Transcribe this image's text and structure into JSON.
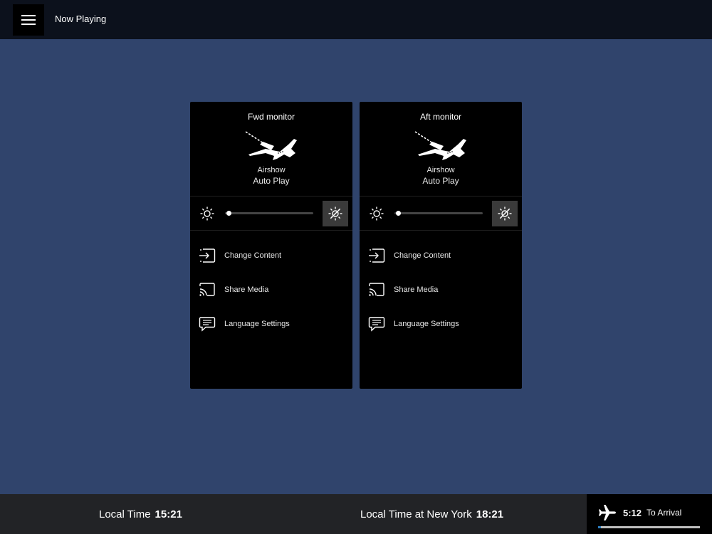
{
  "header": {
    "title": "Now Playing",
    "menu_icon": "hamburger-menu-icon"
  },
  "monitors": [
    {
      "name": "Fwd monitor",
      "source": "Airshow",
      "mode": "Auto Play",
      "brightness_percent": 2,
      "menu": [
        {
          "label": "Change Content",
          "icon": "change-content-icon"
        },
        {
          "label": "Share Media",
          "icon": "cast-icon"
        },
        {
          "label": "Language Settings",
          "icon": "chat-icon"
        }
      ]
    },
    {
      "name": "Aft monitor",
      "source": "Airshow",
      "mode": "Auto Play",
      "brightness_percent": 2,
      "menu": [
        {
          "label": "Change Content",
          "icon": "change-content-icon"
        },
        {
          "label": "Share Media",
          "icon": "cast-icon"
        },
        {
          "label": "Language Settings",
          "icon": "chat-icon"
        }
      ]
    }
  ],
  "footer": {
    "local_time_label": "Local Time",
    "local_time": "15:21",
    "dest_time_label": "Local Time at New York",
    "dest_time": "18:21",
    "arrival_time": "5:12",
    "arrival_label": "To Arrival",
    "flight_progress_percent": 1
  },
  "colors": {
    "background": "#30446c",
    "topbar": "#0c111c",
    "footer": "#222326",
    "progress": "#2d7fc1"
  }
}
